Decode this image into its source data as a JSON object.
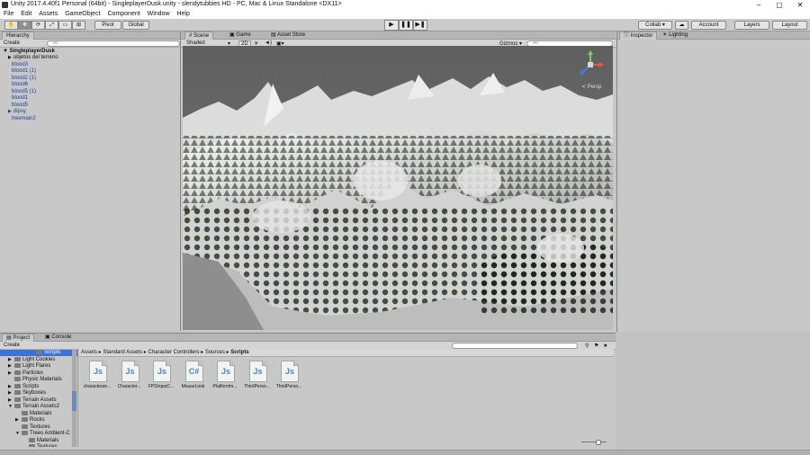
{
  "window": {
    "title": "Unity 2017.4.40f1 Personal (64bit) - SingleplayerDusk.unity - slendytubbies HD - PC, Mac & Linux Standalone <DX11>",
    "minimize": "–",
    "maximize": "▢",
    "close": "✕"
  },
  "menu": [
    "File",
    "Edit",
    "Assets",
    "GameObject",
    "Component",
    "Window",
    "Help"
  ],
  "toolbar": {
    "tools": [
      "✋",
      "✥",
      "⟳",
      "⤢",
      "▭",
      "⊞"
    ],
    "pivot": "Pivot",
    "global": "Global",
    "play": "▶",
    "pause": "❚❚",
    "step": "▶❚",
    "collab": "Collab ▾",
    "cloud": "☁",
    "account": "Account",
    "layers": "Layers",
    "layout": "Layout"
  },
  "hierarchy": {
    "tab": "Hierarchy",
    "create": "Create",
    "search_placeholder": "All",
    "scene": "SingleplayerDusk",
    "items": [
      {
        "label": "objetos del terreno",
        "arrow": "▶",
        "blue": false
      },
      {
        "label": "blood3",
        "arrow": "",
        "blue": true
      },
      {
        "label": "blood1 (1)",
        "arrow": "",
        "blue": true
      },
      {
        "label": "blood2 (1)",
        "arrow": "",
        "blue": true
      },
      {
        "label": "blood6",
        "arrow": "",
        "blue": true
      },
      {
        "label": "blood5 (1)",
        "arrow": "",
        "blue": true
      },
      {
        "label": "blood1",
        "arrow": "",
        "blue": true
      },
      {
        "label": "blood5",
        "arrow": "",
        "blue": true
      },
      {
        "label": "dipsy",
        "arrow": "▶",
        "blue": true
      },
      {
        "label": "treemain2",
        "arrow": "",
        "blue": true
      }
    ]
  },
  "scene": {
    "tabs": [
      "Scene",
      "Game",
      "Asset Store"
    ],
    "shading": "Shaded",
    "mode2d": "2D",
    "gizmos": "Gizmos ▾",
    "search_placeholder": "All",
    "gizmo_label": "≺ Persp",
    "gizmo_y": "y",
    "gizmo_x": "x",
    "gizmo_z": "z"
  },
  "inspector": {
    "tabs": [
      "Inspector",
      "Lighting"
    ]
  },
  "project": {
    "tabs": [
      "Project",
      "Console"
    ],
    "create": "Create",
    "folders": [
      {
        "label": "Scripts",
        "arrow": "",
        "selected": true
      },
      {
        "label": "Light Cookies",
        "arrow": "▶",
        "selected": false
      },
      {
        "label": "Light Flares",
        "arrow": "▶",
        "selected": false
      },
      {
        "label": "Particles",
        "arrow": "▶",
        "selected": false
      },
      {
        "label": "Physic Materials",
        "arrow": "",
        "selected": false
      },
      {
        "label": "Scripts",
        "arrow": "▶",
        "selected": false
      },
      {
        "label": "Skyboxes",
        "arrow": "▶",
        "selected": false
      },
      {
        "label": "Terrain Assets",
        "arrow": "▶",
        "selected": false
      },
      {
        "label": "Terrain Assets2",
        "arrow": "▼",
        "selected": false
      },
      {
        "label": "Materials",
        "arrow": "",
        "selected": false
      },
      {
        "label": "Rocks",
        "arrow": "▶",
        "selected": false
      },
      {
        "label": "Textures",
        "arrow": "",
        "selected": false
      },
      {
        "label": "Trees Ambient-C",
        "arrow": "▼",
        "selected": false
      },
      {
        "label": "Materials",
        "arrow": "",
        "selected": false
      },
      {
        "label": "Textures",
        "arrow": "",
        "selected": false
      }
    ],
    "breadcrumb": [
      "Assets",
      "Standard Assets",
      "Character Controllers",
      "Sources",
      "Scripts"
    ],
    "files": [
      {
        "icon": "Js",
        "label": "characteran..."
      },
      {
        "icon": "Js",
        "label": "Character..."
      },
      {
        "icon": "Js",
        "label": "FPSInputC..."
      },
      {
        "icon": "C#",
        "label": "MouseLook"
      },
      {
        "icon": "Js",
        "label": "PlatformIn..."
      },
      {
        "icon": "Js",
        "label": "ThirdPerso..."
      },
      {
        "icon": "Js",
        "label": "ThirdPerso..."
      }
    ]
  },
  "colors": {
    "accent_blue": "#3a72d9",
    "link_blue": "#1d3f9e",
    "panel_bg": "#c2c2c2"
  }
}
